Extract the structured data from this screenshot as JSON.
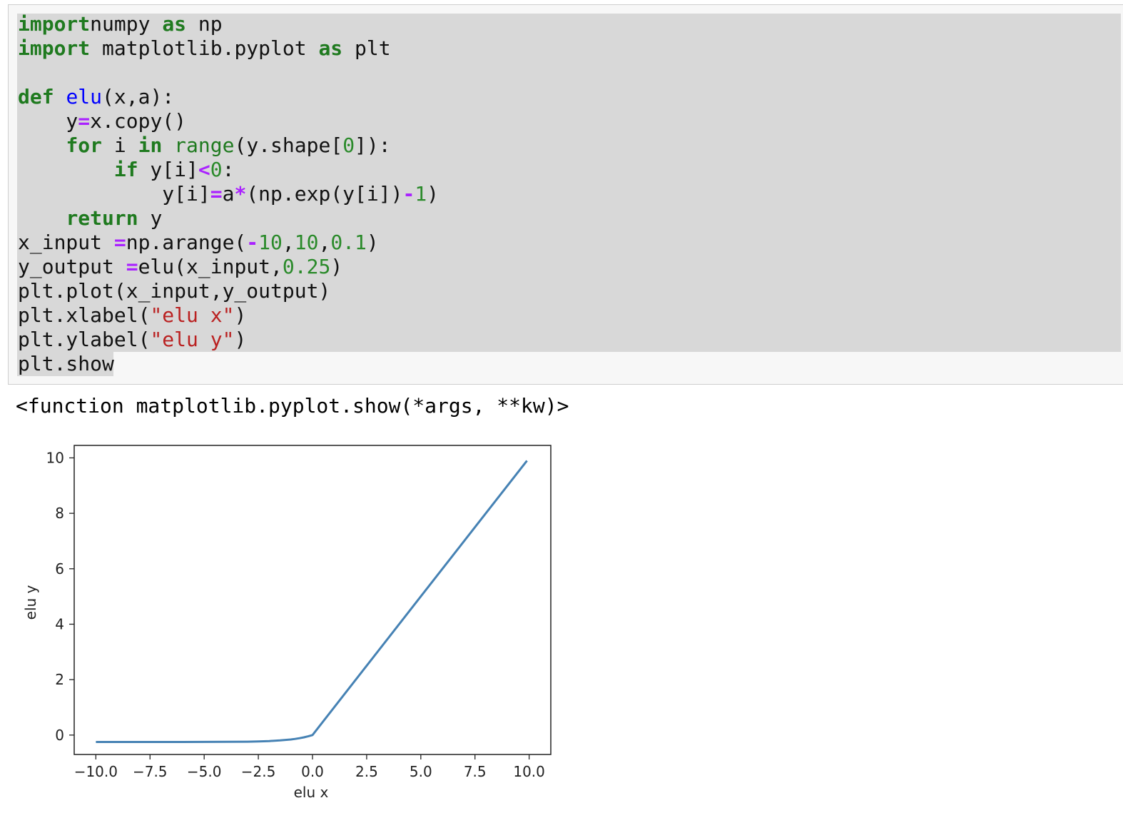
{
  "code_cell": {
    "lines": [
      [
        [
          "kw",
          "import"
        ],
        [
          "",
          "numpy "
        ],
        [
          "kw",
          "as"
        ],
        [
          "",
          " np"
        ]
      ],
      [
        [
          "kw",
          "import"
        ],
        [
          "",
          " matplotlib.pyplot "
        ],
        [
          "kw",
          "as"
        ],
        [
          "",
          " plt"
        ]
      ],
      [
        [
          "",
          ""
        ]
      ],
      [
        [
          "kw",
          "def"
        ],
        [
          "",
          " "
        ],
        [
          "fn",
          "elu"
        ],
        [
          "",
          "(x,a):"
        ]
      ],
      [
        [
          "",
          "    y"
        ],
        [
          "op",
          "="
        ],
        [
          "",
          "x.copy()"
        ]
      ],
      [
        [
          "",
          "    "
        ],
        [
          "kw",
          "for"
        ],
        [
          "",
          " i "
        ],
        [
          "kw",
          "in"
        ],
        [
          "",
          " "
        ],
        [
          "bi",
          "range"
        ],
        [
          "",
          "(y.shape["
        ],
        [
          "num",
          "0"
        ],
        [
          "",
          "]):"
        ]
      ],
      [
        [
          "",
          "        "
        ],
        [
          "kw",
          "if"
        ],
        [
          "",
          " y[i]"
        ],
        [
          "op",
          "<"
        ],
        [
          "num",
          "0"
        ],
        [
          "",
          ":"
        ]
      ],
      [
        [
          "",
          "            y[i]"
        ],
        [
          "op",
          "="
        ],
        [
          "",
          "a"
        ],
        [
          "op",
          "*"
        ],
        [
          "",
          "(np.exp(y[i])"
        ],
        [
          "op",
          "-"
        ],
        [
          "num",
          "1"
        ],
        [
          "",
          ")"
        ]
      ],
      [
        [
          "",
          "    "
        ],
        [
          "kw",
          "return"
        ],
        [
          "",
          " y"
        ]
      ],
      [
        [
          "",
          "x_input "
        ],
        [
          "op",
          "="
        ],
        [
          "",
          "np.arange("
        ],
        [
          "op",
          "-"
        ],
        [
          "num",
          "10"
        ],
        [
          "",
          ","
        ],
        [
          "num",
          "10"
        ],
        [
          "",
          ","
        ],
        [
          "num",
          "0.1"
        ],
        [
          "",
          ")"
        ]
      ],
      [
        [
          "",
          "y_output "
        ],
        [
          "op",
          "="
        ],
        [
          "",
          "elu(x_input,"
        ],
        [
          "num",
          "0.25"
        ],
        [
          "",
          ")"
        ]
      ],
      [
        [
          "",
          "plt.plot(x_input,y_output)"
        ]
      ],
      [
        [
          "",
          "plt.xlabel("
        ],
        [
          "str",
          "\"elu x\""
        ],
        [
          "",
          ")"
        ]
      ],
      [
        [
          "",
          "plt.ylabel("
        ],
        [
          "str",
          "\"elu y\""
        ],
        [
          "",
          ")"
        ]
      ],
      [
        [
          "",
          "plt.show"
        ]
      ]
    ]
  },
  "output": {
    "text": "<function matplotlib.pyplot.show(*args, **kw)>"
  },
  "chart_data": {
    "type": "line",
    "title": "",
    "xlabel": "elu x",
    "ylabel": "elu y",
    "xlim": [
      -11,
      11
    ],
    "ylim": [
      -0.7,
      10.45
    ],
    "xticks": [
      -10.0,
      -7.5,
      -5.0,
      -2.5,
      0.0,
      2.5,
      5.0,
      7.5,
      10.0
    ],
    "xtick_labels": [
      "−10.0",
      "−7.5",
      "−5.0",
      "−2.5",
      "0.0",
      "2.5",
      "5.0",
      "7.5",
      "10.0"
    ],
    "yticks": [
      0,
      2,
      4,
      6,
      8,
      10
    ],
    "ytick_labels": [
      "0",
      "2",
      "4",
      "6",
      "8",
      "10"
    ],
    "grid": false,
    "line_color": "#4682b4",
    "series": [
      {
        "x": [
          -10,
          -9,
          -8,
          -7,
          -6,
          -5,
          -4,
          -3,
          -2.5,
          -2,
          -1.5,
          -1,
          -0.8,
          -0.6,
          -0.4,
          -0.2,
          0,
          2.5,
          5,
          7.5,
          9.9
        ],
        "y": [
          -0.25,
          -0.25,
          -0.25,
          -0.25,
          -0.249,
          -0.248,
          -0.245,
          -0.238,
          -0.229,
          -0.216,
          -0.194,
          -0.158,
          -0.138,
          -0.113,
          -0.082,
          -0.045,
          0,
          2.5,
          5,
          7.5,
          9.9
        ]
      }
    ]
  }
}
